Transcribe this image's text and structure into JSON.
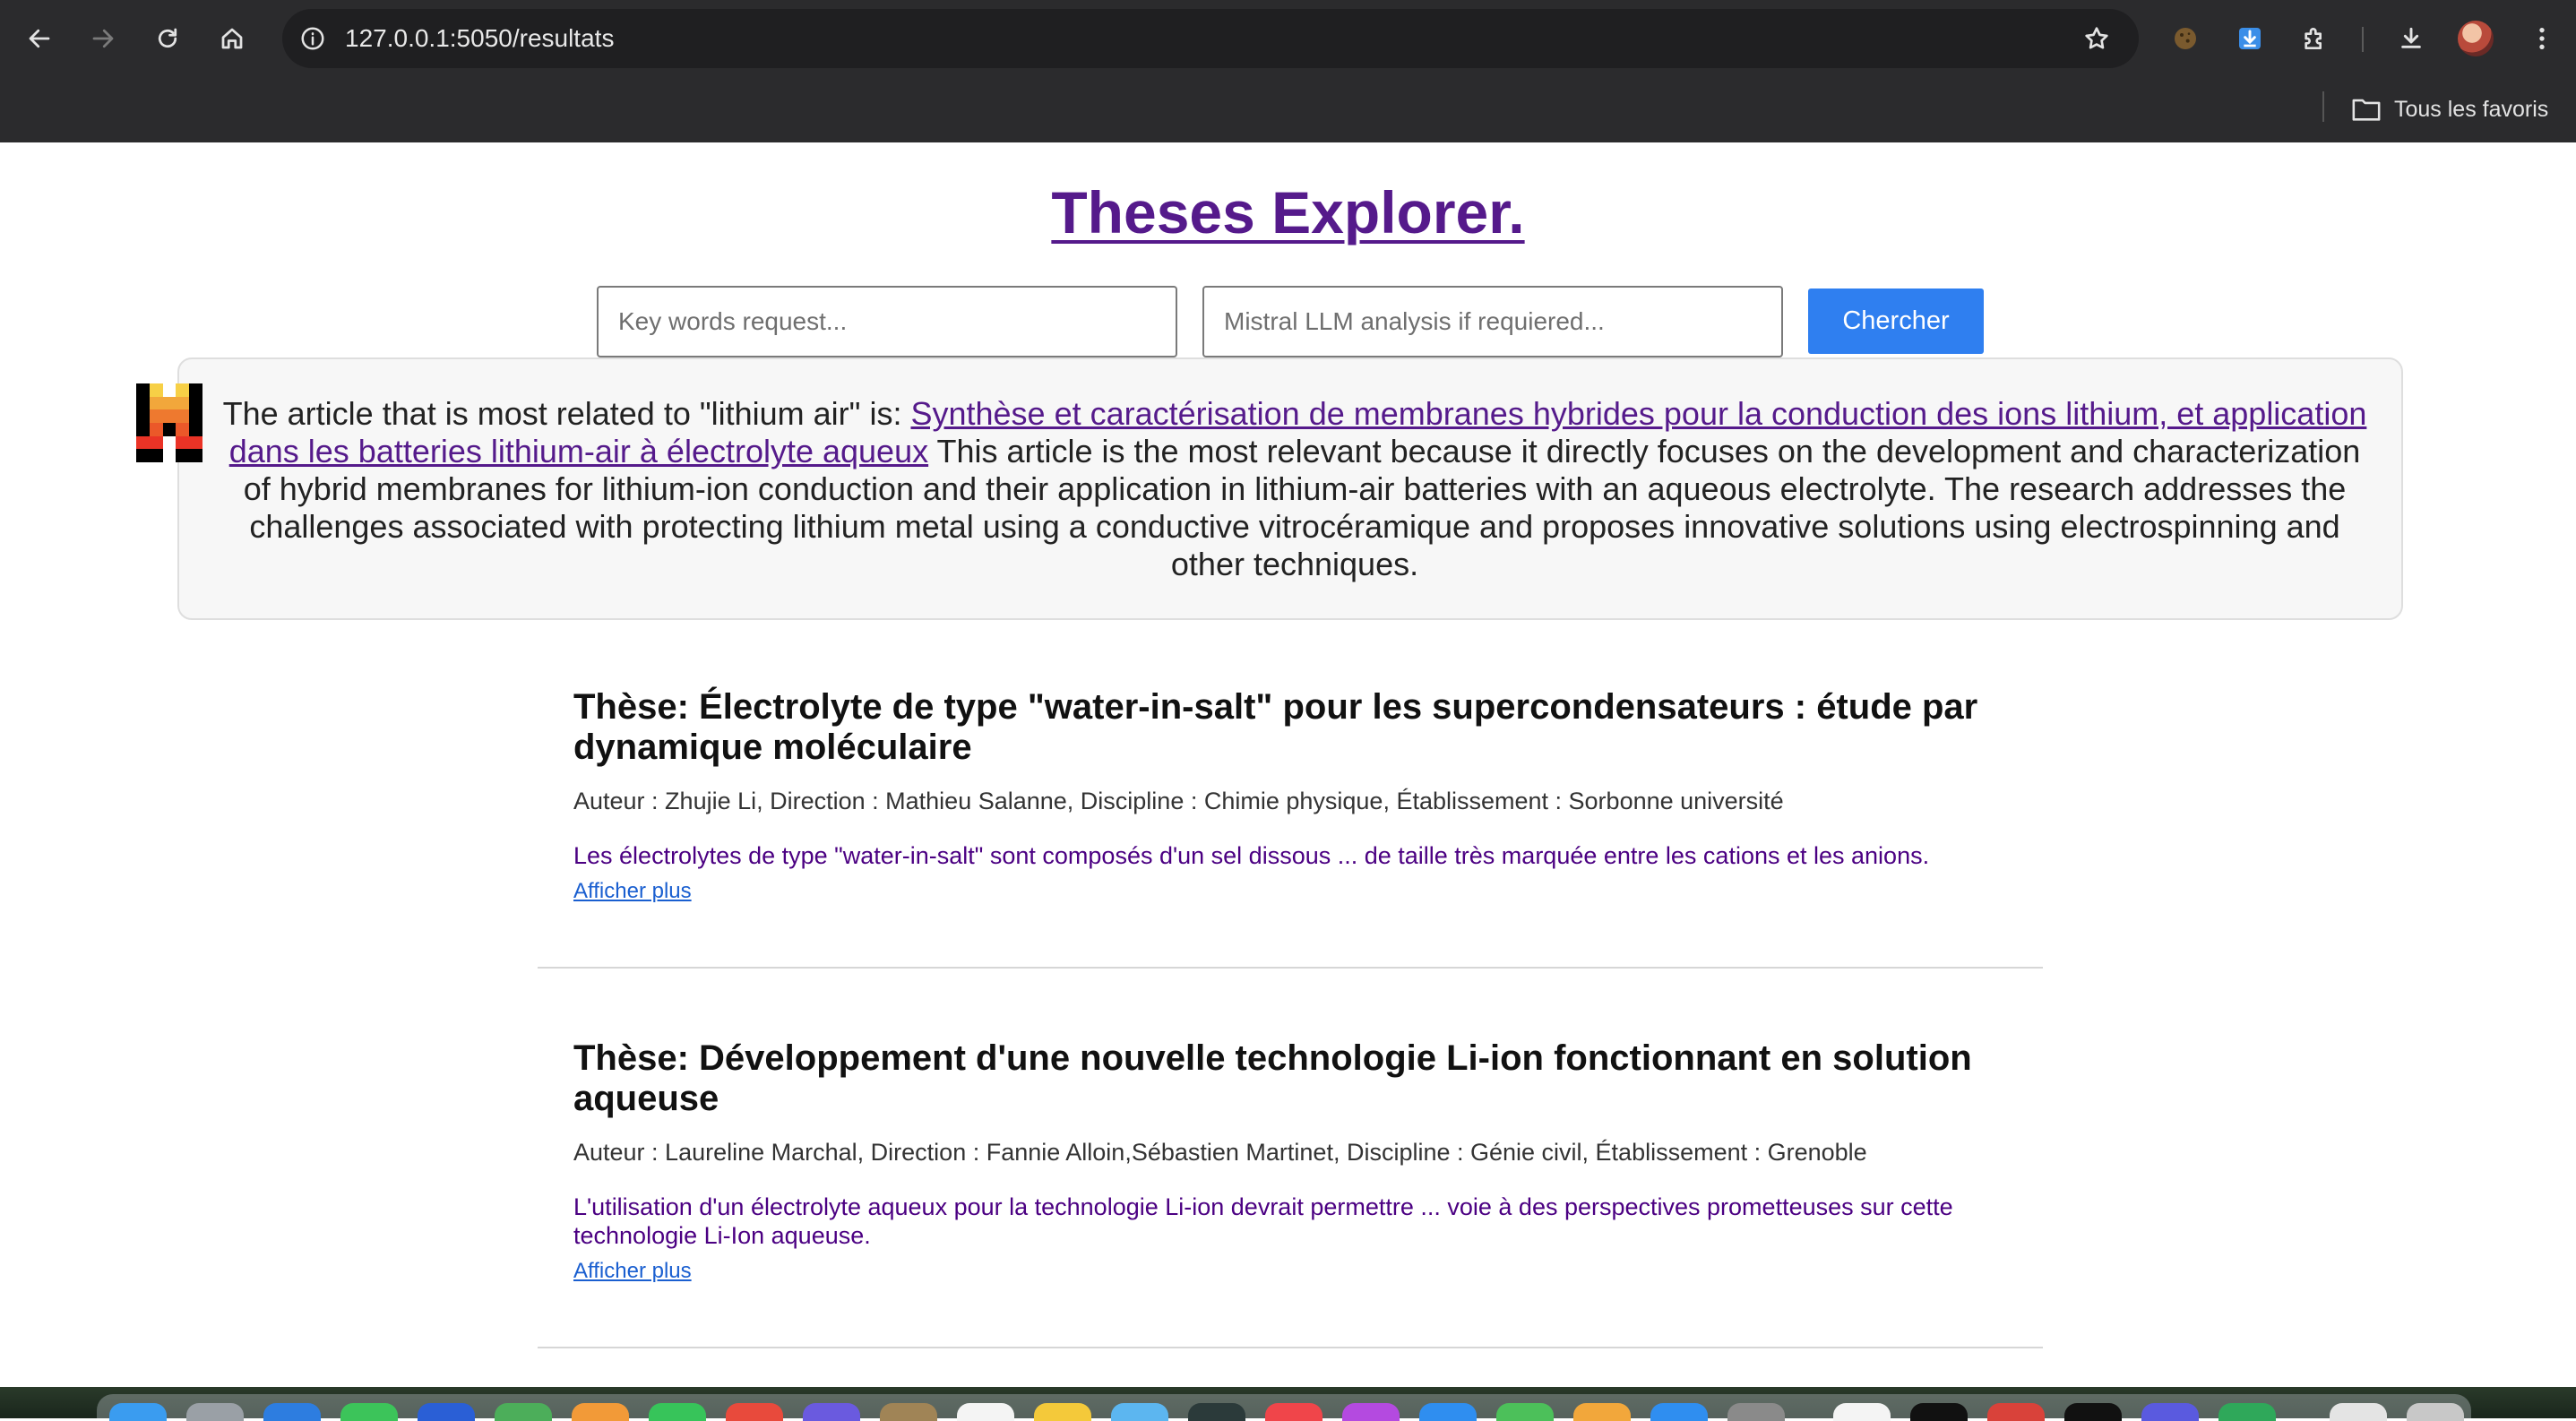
{
  "browser": {
    "url": "127.0.0.1:5050/resultats",
    "bookmarks_folder": "Tous les favoris"
  },
  "header": {
    "title": "Theses Explorer."
  },
  "search": {
    "keywords_placeholder": "Key words request...",
    "llm_placeholder": "Mistral LLM analysis if requiered...",
    "button_label": "Chercher"
  },
  "llm": {
    "intro": "The article that is most related to \"lithium air\" is: ",
    "link_text": "Synthèse et caractérisation de membranes hybrides pour la conduction des ions lithium, et application dans les batteries lithium-air à électrolyte aqueux",
    "explanation": " This article is the most relevant because it directly focuses on the development and characterization of hybrid membranes for lithium-ion conduction and their application in lithium-air batteries with an aqueous electrolyte. The research addresses the challenges associated with protecting lithium metal using a conductive vitrocéramique and proposes innovative solutions using electrospinning and other techniques."
  },
  "results": [
    {
      "title": "Thèse: Électrolyte de type \"water-in-salt\" pour les supercondensateurs : étude par dynamique moléculaire",
      "meta": "Auteur : Zhujie Li, Direction : Mathieu Salanne, Discipline : Chimie physique, Établissement : Sorbonne université",
      "abstract": "Les électrolytes de type \"water-in-salt\" sont composés d'un sel dissous ... de taille très marquée entre les cations et les anions.",
      "more": "Afficher plus"
    },
    {
      "title": "Thèse: Développement d'une nouvelle technologie Li-ion fonctionnant en solution aqueuse",
      "meta": "Auteur : Laureline Marchal, Direction : Fannie Alloin,Sébastien Martinet, Discipline : Génie civil, Établissement : Grenoble",
      "abstract": "L'utilisation d'un électrolyte aqueux pour la technologie Li-ion devrait permettre ... voie à des perspectives prometteuses sur cette technologie Li-Ion aqueuse.",
      "more": "Afficher plus"
    }
  ],
  "colors": {
    "accent": "#2f7ff0",
    "title": "#551a8b",
    "abstract": "#4b0082",
    "link": "#1a5fd0"
  },
  "icons": [
    "back-icon",
    "forward-icon",
    "reload-icon",
    "home-icon",
    "info-icon",
    "star-icon",
    "cookie-extension-icon",
    "download-extension-icon",
    "puzzle-icon",
    "downloads-icon",
    "profile-avatar",
    "menu-icon",
    "folder-icon",
    "mistral-logo"
  ]
}
